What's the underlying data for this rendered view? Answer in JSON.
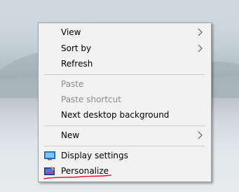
{
  "context_menu": {
    "items": [
      {
        "label": "View",
        "disabled": false,
        "submenu": true
      },
      {
        "label": "Sort by",
        "disabled": false,
        "submenu": true
      },
      {
        "label": "Refresh",
        "disabled": false,
        "submenu": false
      },
      {
        "label": "Paste",
        "disabled": true,
        "submenu": false
      },
      {
        "label": "Paste shortcut",
        "disabled": true,
        "submenu": false
      },
      {
        "label": "Next desktop background",
        "disabled": false,
        "submenu": false
      },
      {
        "label": "New",
        "disabled": false,
        "submenu": true
      },
      {
        "label": "Display settings",
        "disabled": false,
        "submenu": false,
        "icon": "monitor-icon"
      },
      {
        "label": "Personalize",
        "disabled": false,
        "submenu": false,
        "icon": "personalize-icon"
      }
    ]
  },
  "colors": {
    "menu_background": "#f2f2f2",
    "disabled_text": "#8c8c8c",
    "annotation_underline": "#e0142a"
  }
}
